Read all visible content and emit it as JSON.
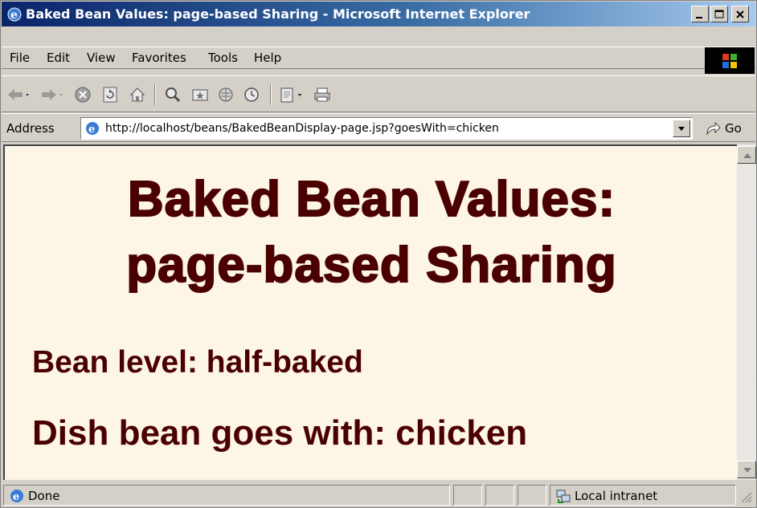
{
  "window": {
    "title": "Baked Bean Values: page-based Sharing - Microsoft Internet Explorer",
    "controls": [
      "minimize-icon",
      "maximize-icon",
      "close-icon"
    ]
  },
  "menu": {
    "items": [
      "File",
      "Edit",
      "View",
      "Favorites",
      "Tools",
      "Help"
    ]
  },
  "toolbar": {
    "icons": [
      "back-icon",
      "forward-icon",
      "stop-icon",
      "refresh-icon",
      "home-icon",
      "search-icon",
      "favorites-icon",
      "media-icon",
      "history-icon",
      "edit-icon",
      "print-icon"
    ]
  },
  "address": {
    "label": "Address",
    "url": "http://localhost/beans/BakedBeanDisplay-page.jsp?goesWith=chicken",
    "go_label": "Go"
  },
  "page": {
    "heading_line1": "Baked Bean Values:",
    "heading_line2": "page-based Sharing",
    "bean_level": "Bean level: half-baked",
    "goes_with": "Dish bean goes with: chicken",
    "text_color": "#4a0000",
    "background_color": "#fdf5e6"
  },
  "status": {
    "text": "Done",
    "zone": "Local intranet"
  }
}
